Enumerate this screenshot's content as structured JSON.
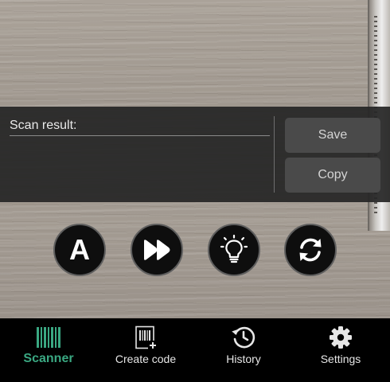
{
  "result_panel": {
    "label": "Scan result:",
    "value": "",
    "save_label": "Save",
    "copy_label": "Copy"
  },
  "controls": {
    "auto_focus_letter": "A",
    "fast_forward_icon": "fast-forward-icon",
    "flashlight_icon": "lightbulb-icon",
    "switch_camera_icon": "sync-icon"
  },
  "nav": {
    "items": [
      {
        "label": "Scanner",
        "icon": "barcode-icon",
        "active": true
      },
      {
        "label": "Create code",
        "icon": "create-barcode-icon",
        "active": false
      },
      {
        "label": "History",
        "icon": "history-icon",
        "active": false
      },
      {
        "label": "Settings",
        "icon": "gear-icon",
        "active": false
      }
    ]
  },
  "colors": {
    "accent": "#3aa882",
    "panel_bg": "#262626",
    "button_bg": "#4a4a4a",
    "nav_bg": "#000000"
  }
}
